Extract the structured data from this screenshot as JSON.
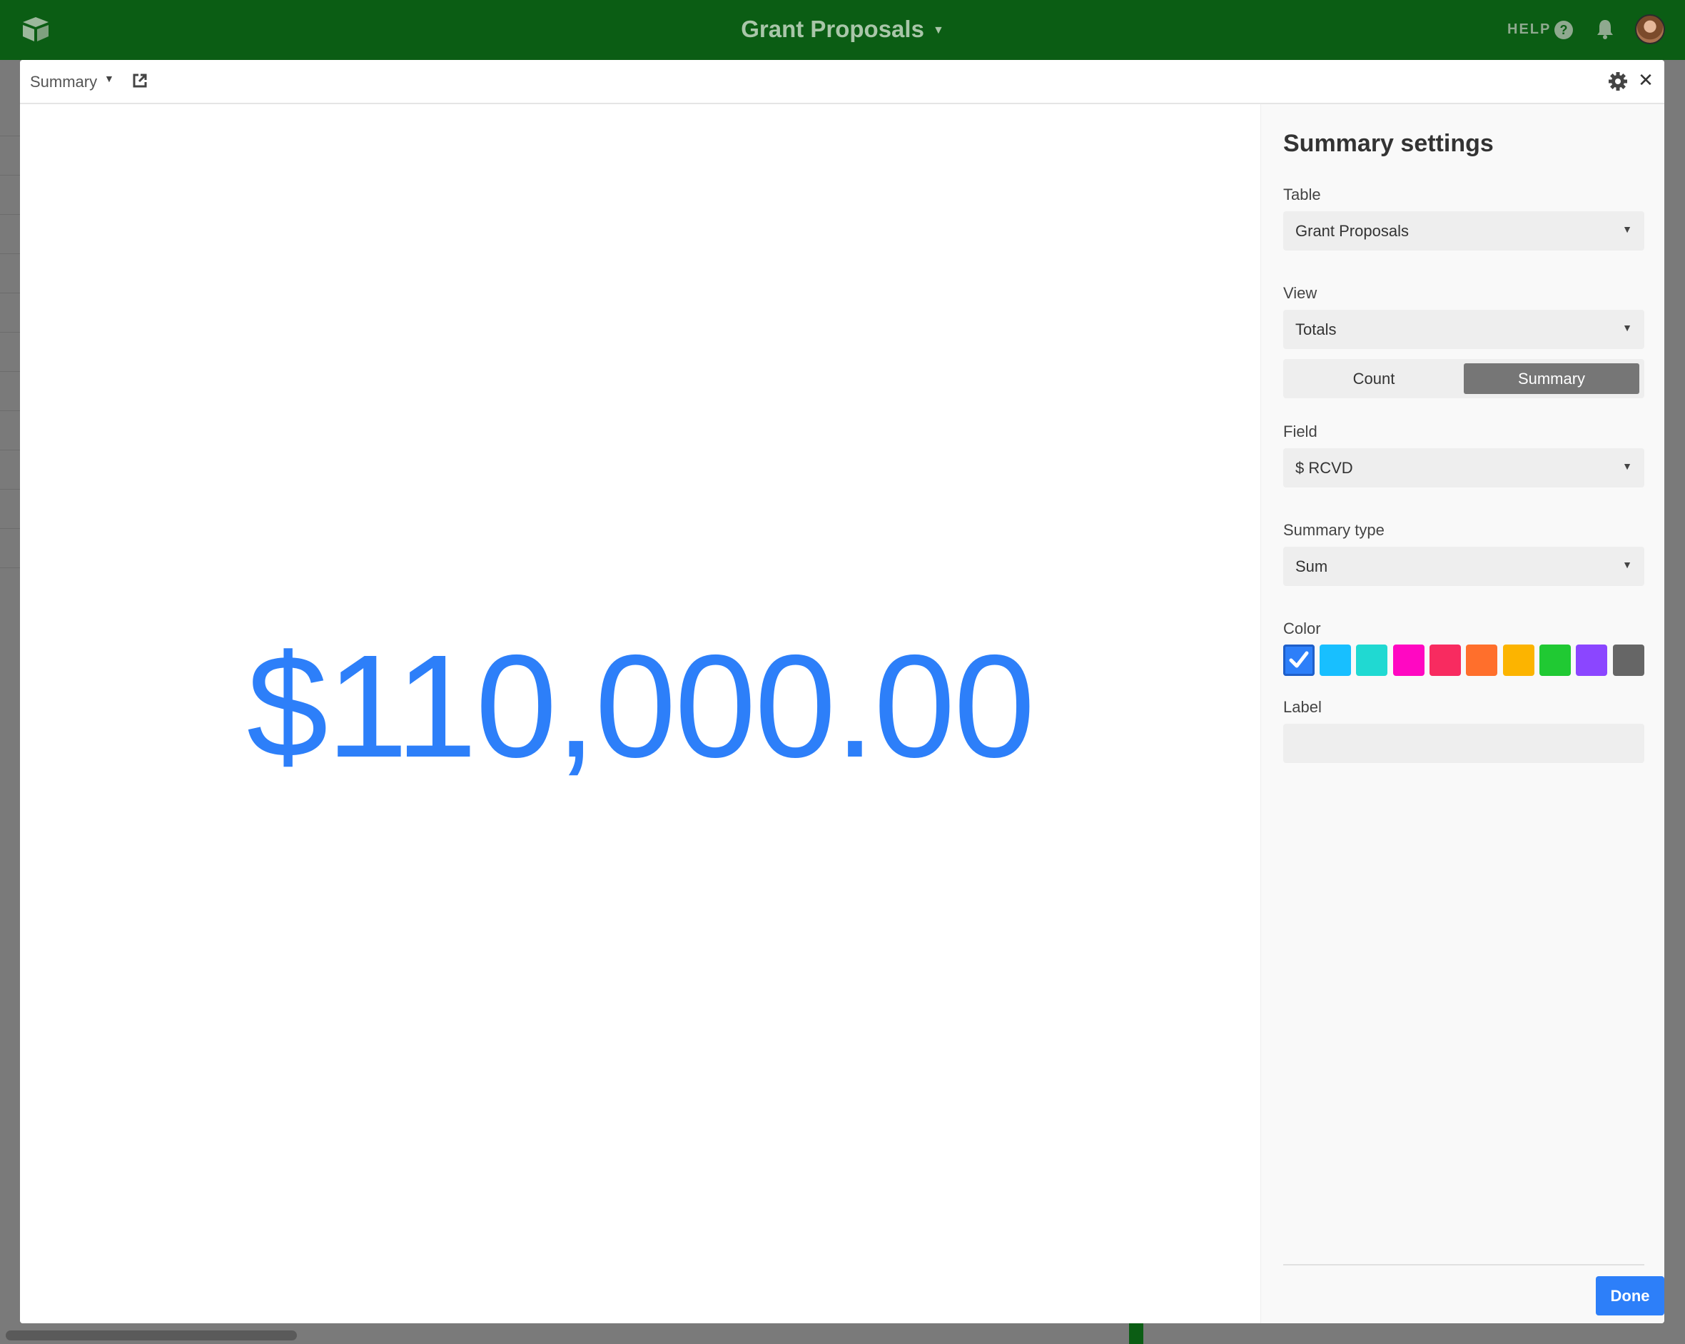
{
  "topbar": {
    "base_title": "Grant Proposals",
    "help_label": "HELP",
    "colors": {
      "bar": "#0b5d14"
    }
  },
  "modal": {
    "block_name": "Summary",
    "big_value": "$110,000.00",
    "value_color": "#2d7ff9"
  },
  "settings": {
    "title": "Summary settings",
    "table": {
      "label": "Table",
      "value": "Grant Proposals"
    },
    "view": {
      "label": "View",
      "value": "Totals"
    },
    "mode": {
      "options": [
        "Count",
        "Summary"
      ],
      "selected": "Summary"
    },
    "field": {
      "label": "Field",
      "value": "$ RCVD"
    },
    "summary_type": {
      "label": "Summary type",
      "value": "Sum"
    },
    "color": {
      "label": "Color",
      "swatches": [
        "#2d7ff9",
        "#18bfff",
        "#20d9d2",
        "#ff08c2",
        "#f82b60",
        "#ff6f2c",
        "#fcb400",
        "#20c933",
        "#8b46ff",
        "#666666"
      ],
      "selected_index": 0
    },
    "label_field": {
      "label": "Label",
      "value": ""
    },
    "done_label": "Done"
  }
}
